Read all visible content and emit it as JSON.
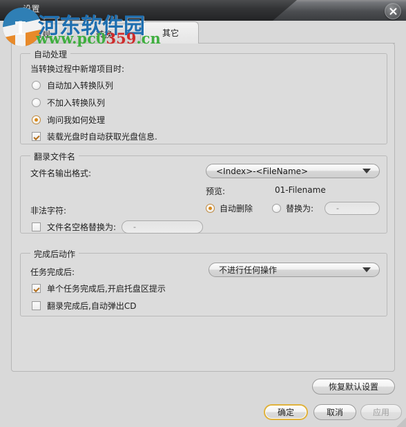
{
  "window": {
    "title": "设置",
    "close_label": "关闭"
  },
  "watermark": {
    "site_name": "河东软件园",
    "url_green_1": "www.pc0",
    "url_red": "359",
    "url_green_2": ".cn",
    "logo_digit": "1"
  },
  "tabs": [
    {
      "label": "常规",
      "selected": false
    },
    {
      "label": "转换",
      "selected": false
    },
    {
      "label": "其它",
      "selected": true
    }
  ],
  "groups": {
    "auto": {
      "title": "自动处理",
      "prompt": "当转换过程中新增项目时:",
      "options": [
        {
          "label": "自动加入转换队列",
          "checked": false
        },
        {
          "label": "不加入转换队列",
          "checked": false
        },
        {
          "label": "询问我如何处理",
          "checked": true
        }
      ],
      "disc_checkbox": {
        "label": "装载光盘时自动获取光盘信息.",
        "checked": true
      }
    },
    "rip": {
      "title": "翻录文件名",
      "format_label": "文件名输出格式:",
      "format_value": "<Index>-<FileName>",
      "preview_label": "预览:",
      "preview_value": "01-Filename",
      "illegal_label": "非法字符:",
      "illegal_auto": {
        "label": "自动删除",
        "checked": true
      },
      "illegal_replace": {
        "label": "替换为:",
        "checked": false
      },
      "illegal_replace_value": "-",
      "space_checkbox": {
        "label": "文件名空格替换为:",
        "checked": false
      },
      "space_value": "-"
    },
    "finish": {
      "title": "完成后动作",
      "after_label": "任务完成后:",
      "after_value": "不进行任何操作",
      "tray_checkbox": {
        "label": "单个任务完成后,开启托盘区提示",
        "checked": true
      },
      "eject_checkbox": {
        "label": "翻录完成后,自动弹出CD",
        "checked": false
      }
    }
  },
  "buttons": {
    "restore": "恢复默认设置",
    "ok": "确定",
    "cancel": "取消",
    "apply": "应用"
  },
  "colors": {
    "accent": "#d98819",
    "default_button_border": "#e0b23c",
    "watermark_blue": "#1f6fb0",
    "watermark_green": "#3fae3f",
    "watermark_red": "#cf2b2b",
    "panel_bg": "#dcdcdc",
    "titlebar_dark": "#343537"
  }
}
